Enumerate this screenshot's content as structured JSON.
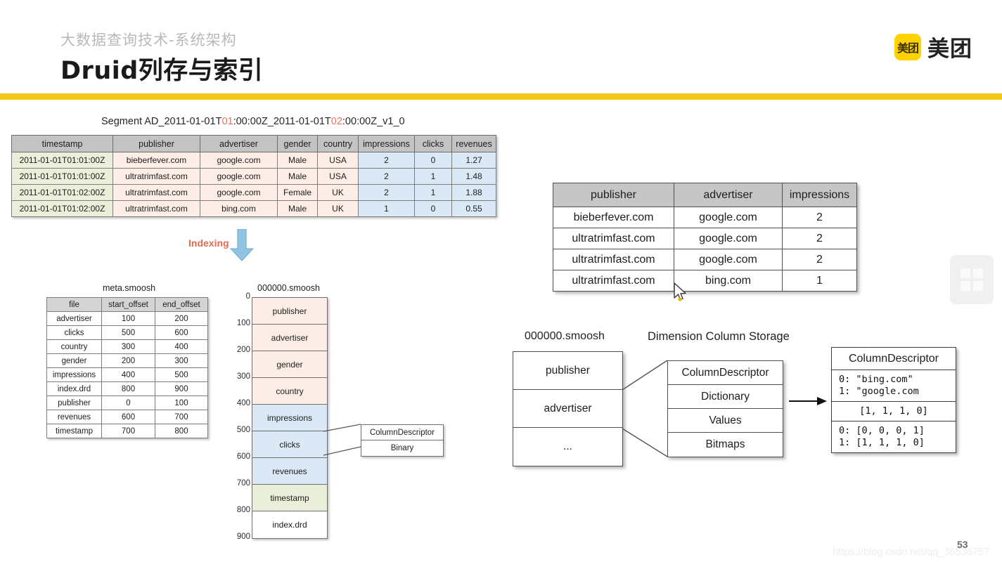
{
  "header": {
    "subtitle": "大数据查询技术-系统架构",
    "title": "Druid列存与索引",
    "logo_mark": "美团",
    "logo_text": "美团",
    "accent_color": "#f5c518"
  },
  "segment": {
    "title_prefix": "Segment AD_2011-01-01T",
    "title_hl1": "01",
    "title_mid": ":00:00Z_2011-01-01T",
    "title_hl2": "02",
    "title_suffix": ":00:00Z_v1_0",
    "columns": [
      "timestamp",
      "publisher",
      "advertiser",
      "gender",
      "country",
      "impressions",
      "clicks",
      "revenues"
    ],
    "rows": [
      [
        "2011-01-01T01:01:00Z",
        "bieberfever.com",
        "google.com",
        "Male",
        "USA",
        "2",
        "0",
        "1.27"
      ],
      [
        "2011-01-01T01:01:00Z",
        "ultratrimfast.com",
        "google.com",
        "Male",
        "USA",
        "2",
        "1",
        "1.48"
      ],
      [
        "2011-01-01T01:02:00Z",
        "ultratrimfast.com",
        "google.com",
        "Female",
        "UK",
        "2",
        "1",
        "1.88"
      ],
      [
        "2011-01-01T01:02:00Z",
        "ultratrimfast.com",
        "bing.com",
        "Male",
        "UK",
        "1",
        "0",
        "0.55"
      ]
    ],
    "colors": {
      "header": "#c3c3c3",
      "timestamp": "#e9efd8",
      "dimension": "#fceee6",
      "metric": "#dbe8f6"
    }
  },
  "indexing": {
    "label": "Indexing",
    "label_color": "#e06a4f",
    "arrow_color": "#7fb8dd",
    "arrow_icon": "arrow-down-icon"
  },
  "meta_smoosh": {
    "caption": "meta.smoosh",
    "columns": [
      "file",
      "start_offset",
      "end_offset"
    ],
    "rows": [
      [
        "advertiser",
        "100",
        "200"
      ],
      [
        "clicks",
        "500",
        "600"
      ],
      [
        "country",
        "300",
        "400"
      ],
      [
        "gender",
        "200",
        "300"
      ],
      [
        "impressions",
        "400",
        "500"
      ],
      [
        "index.drd",
        "800",
        "900"
      ],
      [
        "publisher",
        "0",
        "100"
      ],
      [
        "revenues",
        "600",
        "700"
      ],
      [
        "timestamp",
        "700",
        "800"
      ]
    ]
  },
  "smoosh_column": {
    "caption": "000000.smoosh",
    "ticks": [
      "0",
      "100",
      "200",
      "300",
      "400",
      "500",
      "600",
      "700",
      "800",
      "900"
    ],
    "cells": [
      {
        "label": "publisher",
        "kind": "dim"
      },
      {
        "label": "advertiser",
        "kind": "dim"
      },
      {
        "label": "gender",
        "kind": "dim"
      },
      {
        "label": "country",
        "kind": "dim"
      },
      {
        "label": "impressions",
        "kind": "met"
      },
      {
        "label": "clicks",
        "kind": "met"
      },
      {
        "label": "revenues",
        "kind": "met"
      },
      {
        "label": "timestamp",
        "kind": "ts"
      },
      {
        "label": "index.drd",
        "kind": "idx"
      }
    ]
  },
  "column_binary": {
    "header": "ColumnDescriptor",
    "body": "Binary"
  },
  "dimension_table": {
    "columns": [
      "publisher",
      "advertiser",
      "impressions"
    ],
    "rows": [
      [
        "bieberfever.com",
        "google.com",
        "2"
      ],
      [
        "ultratrimfast.com",
        "google.com",
        "2"
      ],
      [
        "ultratrimfast.com",
        "google.com",
        "2"
      ],
      [
        "ultratrimfast.com",
        "bing.com",
        "1"
      ]
    ]
  },
  "dimension_storage": {
    "smoosh_caption": "000000.smoosh",
    "title": "Dimension Column Storage",
    "smoosh_cells": [
      "publisher",
      "advertiser",
      "..."
    ],
    "descriptor_parts": [
      "ColumnDescriptor",
      "Dictionary",
      "Values",
      "Bitmaps"
    ]
  },
  "column_descriptor_detail": {
    "header": "ColumnDescriptor",
    "dictionary": "0: \"bing.com\"\n1: \"google.com",
    "values": "[1, 1, 1, 0]",
    "bitmaps": "0: [0, 0, 0, 1]\n1: [1, 1, 1, 0]"
  },
  "footer": {
    "watermark": "https://blog.csdn.net/qq_36536757",
    "page_number": "53"
  },
  "apps_icon": "grid-apps-icon",
  "cursor": "mouse-pointer-icon"
}
